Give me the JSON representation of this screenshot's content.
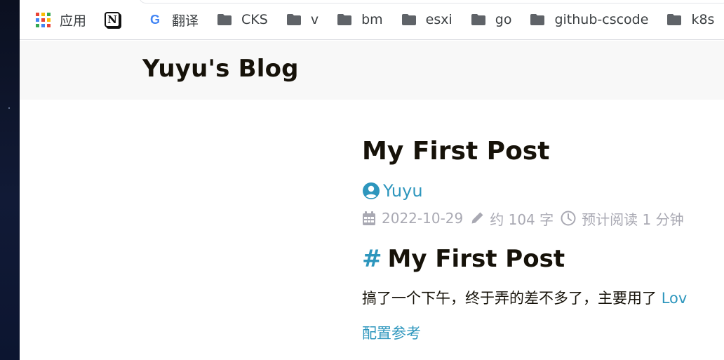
{
  "bookmarks": [
    {
      "label": "应用",
      "icon": "apps-grid-icon"
    },
    {
      "label": "",
      "icon": "notion-icon"
    },
    {
      "label": "翻译",
      "icon": "google-translate-icon"
    },
    {
      "label": "CKS",
      "icon": "folder-icon"
    },
    {
      "label": "v",
      "icon": "folder-icon"
    },
    {
      "label": "bm",
      "icon": "folder-icon"
    },
    {
      "label": "esxi",
      "icon": "folder-icon"
    },
    {
      "label": "go",
      "icon": "folder-icon"
    },
    {
      "label": "github-cscode",
      "icon": "folder-icon"
    },
    {
      "label": "k8s",
      "icon": "folder-icon"
    },
    {
      "label": "",
      "icon": "folder-icon"
    }
  ],
  "notion_glyph": "N",
  "google_glyph": "G",
  "site": {
    "title": "Yuyu's Blog"
  },
  "post": {
    "title": "My First Post",
    "author": "Yuyu",
    "date": "2022-10-29",
    "word_count": "约 104 字",
    "read_time": "预计阅读 1 分钟",
    "heading_hash": "#",
    "heading": "My First Post",
    "paragraph_text": "搞了一个下午，终于弄的差不多了，主要用了 ",
    "paragraph_link": "Lov",
    "config_link": "配置参考"
  },
  "colors": {
    "link": "#2d96bd",
    "meta": "#a9a9b3",
    "text": "#161209",
    "header_bg": "#f8f8f8"
  }
}
